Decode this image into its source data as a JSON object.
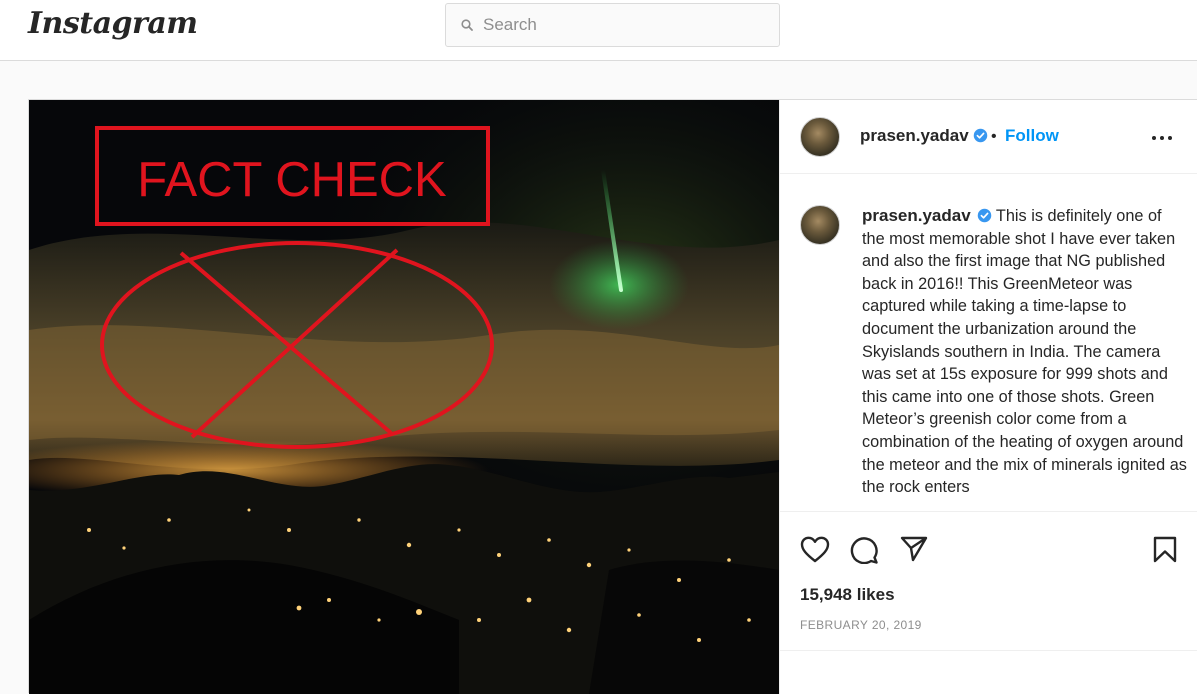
{
  "app": {
    "logo_text": "Instagram"
  },
  "search": {
    "placeholder": "Search"
  },
  "photo": {
    "overlay_text": "FACT CHECK",
    "overlay_color": "#e0141e"
  },
  "post": {
    "username": "prasen.yadav",
    "follow_label": "Follow",
    "dot": "•",
    "caption": "This is definitely one of the most memorable shot I have ever taken and also the first image that NG published back in 2016!! This GreenMeteor was captured while taking a time-lapse to document the urbanization around the Skyislands southern in India. The camera was set at 15s exposure for 999 shots and this came into one of those shots. Green Meteor’s greenish color come from a combination of the heating of oxygen around the meteor and the mix of minerals ignited as the rock enters",
    "likes": "15,948 likes",
    "date": "FEBRUARY 20, 2019"
  },
  "icons": [
    "search-icon",
    "verified-badge-icon",
    "more-options-icon",
    "heart-icon",
    "comment-icon",
    "share-icon",
    "bookmark-icon"
  ],
  "colors": {
    "link": "#0095f6",
    "verified": "#3897f0",
    "text": "#262626",
    "muted": "#8e8e8e"
  }
}
